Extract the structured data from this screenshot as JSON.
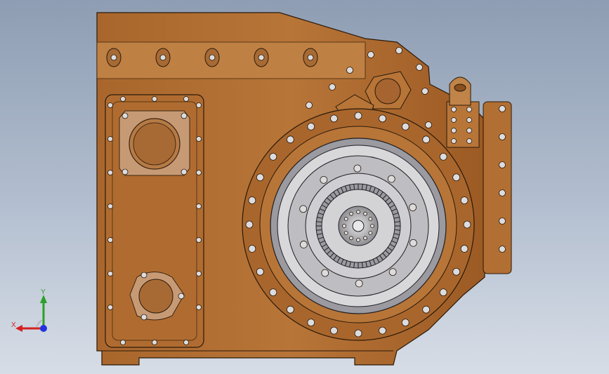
{
  "view": {
    "background_top": "#8e9db3",
    "background_bottom": "#d7dde6"
  },
  "model": {
    "body_color": "#b26f33",
    "body_shadow": "#8a4f1f",
    "body_highlight": "#c98a4c",
    "edge_color": "#2a1a0a",
    "bolt_color": "#d9d9dc",
    "gear_color": "#c9c9cc"
  },
  "triad": {
    "x_label": "X",
    "y_label": "Y",
    "x_color": "#d42020",
    "y_color": "#2aa02a",
    "z_color": "#2233dd"
  }
}
